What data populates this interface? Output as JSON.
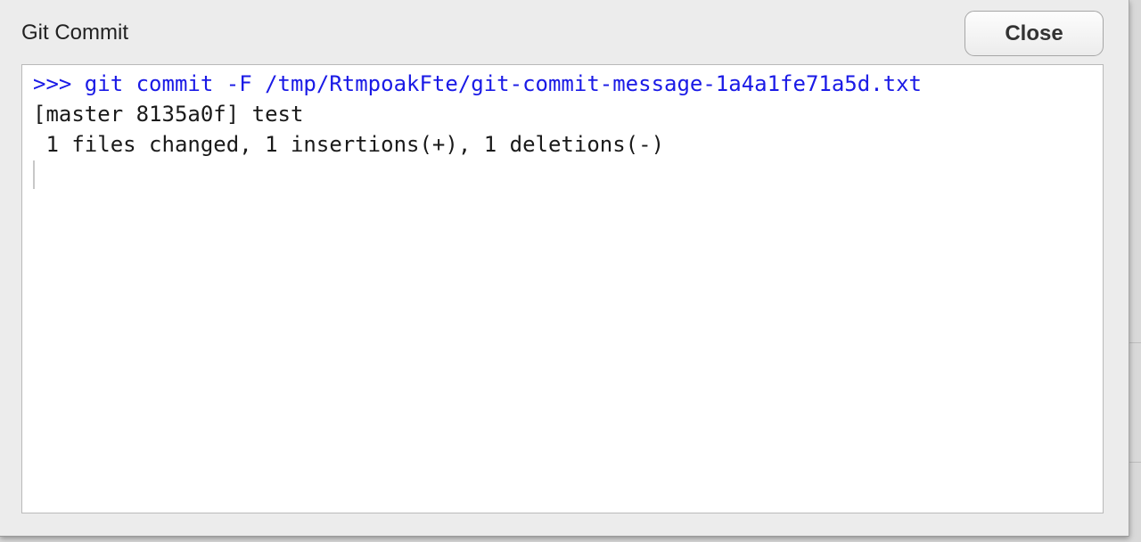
{
  "dialog": {
    "title": "Git Commit",
    "close_label": "Close"
  },
  "console": {
    "lines": [
      {
        "text": ">>> git commit -F /tmp/RtmpoakFte/git-commit-message-1a4a1fe71a5d.txt",
        "kind": "command"
      },
      {
        "text": "[master 8135a0f] test",
        "kind": "output"
      },
      {
        "text": " 1 files changed, 1 insertions(+), 1 deletions(-)",
        "kind": "output"
      }
    ]
  },
  "colors": {
    "command_text": "#1a1ae6",
    "output_text": "#1a1a1a",
    "dialog_background": "#ececec",
    "console_background": "#ffffff"
  }
}
